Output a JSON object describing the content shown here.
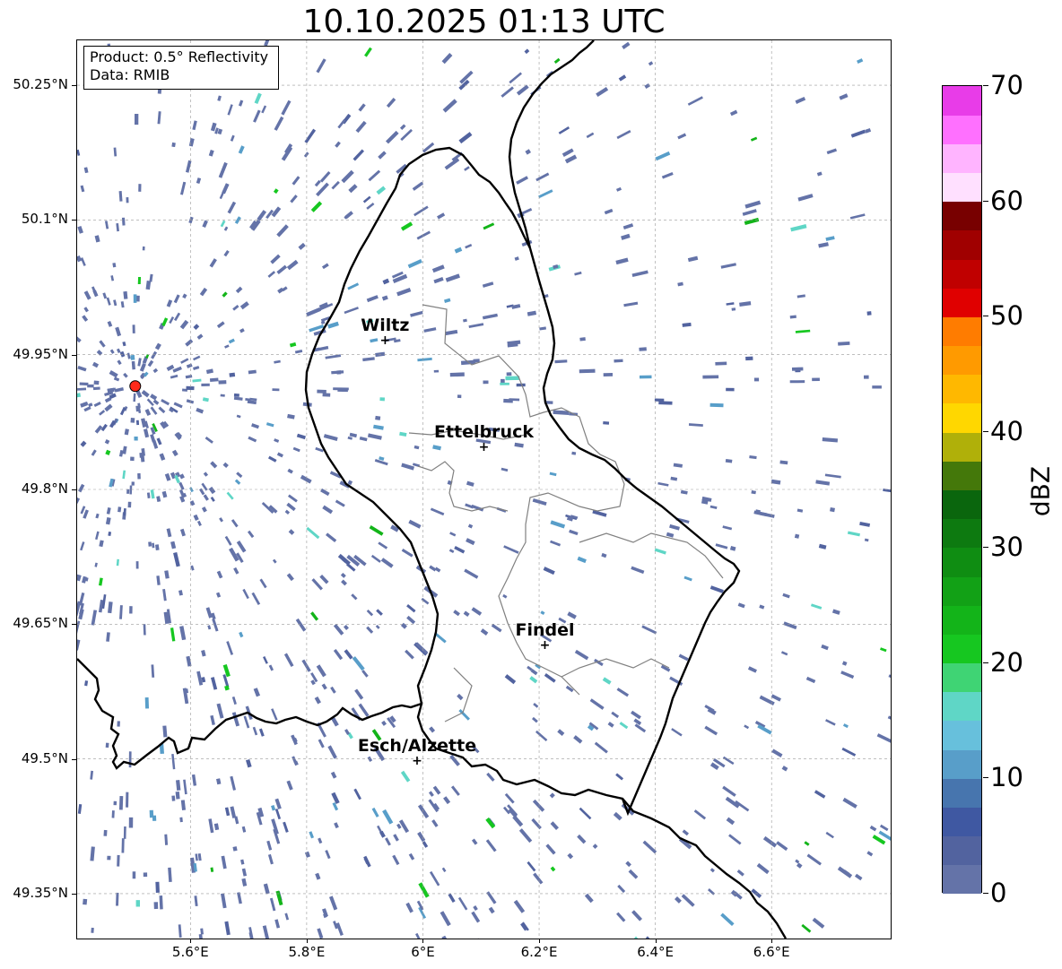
{
  "title": "10.10.2025 01:13 UTC",
  "info_box": {
    "product": "Product: 0.5° Reflectivity",
    "data_source": "Data: RMIB"
  },
  "map": {
    "extent": {
      "lon_min": 5.405,
      "lon_max": 6.805,
      "lat_min": 49.3,
      "lat_max": 50.3
    },
    "lat_ticks": [
      "50.25°N",
      "50.1°N",
      "49.95°N",
      "49.8°N",
      "49.65°N",
      "49.5°N",
      "49.35°N"
    ],
    "lat_values": [
      50.25,
      50.1,
      49.95,
      49.8,
      49.65,
      49.5,
      49.35
    ],
    "lon_ticks": [
      "5.6°E",
      "5.8°E",
      "6°E",
      "6.2°E",
      "6.4°E",
      "6.6°E"
    ],
    "lon_values": [
      5.6,
      5.8,
      6.0,
      6.2,
      6.4,
      6.6
    ],
    "radar_site": {
      "lon": 5.505,
      "lat": 49.915,
      "color": "#ff2a1a"
    },
    "cities": [
      {
        "name": "Wiltz",
        "lon": 5.935,
        "lat": 49.966
      },
      {
        "name": "Ettelbruck",
        "lon": 6.105,
        "lat": 49.847
      },
      {
        "name": "Findel",
        "lon": 6.21,
        "lat": 49.626
      },
      {
        "name": "Esch/Alzette",
        "lon": 5.99,
        "lat": 49.498
      }
    ],
    "city_marker_symbol": "+",
    "gridlines": true,
    "border_color": "#000000",
    "canton_border_color": "#808080"
  },
  "colorbar": {
    "label": "dBZ",
    "min": 0,
    "max": 70,
    "step": 2.5,
    "tick_labels": [
      "0",
      "10",
      "20",
      "30",
      "40",
      "50",
      "60",
      "70"
    ],
    "tick_values": [
      0,
      10,
      20,
      30,
      40,
      50,
      60,
      70
    ],
    "colors": [
      "#6473a8",
      "#52639f",
      "#3f58a2",
      "#4775ae",
      "#589ec9",
      "#67c0dc",
      "#5fd6c6",
      "#3fd474",
      "#16c720",
      "#13b419",
      "#12a116",
      "#0f8d12",
      "#0d7a10",
      "#0a660d",
      "#44780a",
      "#b0b009",
      "#ffd700",
      "#ffb800",
      "#ff9a00",
      "#ff7c00",
      "#e00000",
      "#c00000",
      "#a00000",
      "#780000",
      "#ffe0ff",
      "#ffb4ff",
      "#ff70ff",
      "#e83ce8"
    ]
  }
}
